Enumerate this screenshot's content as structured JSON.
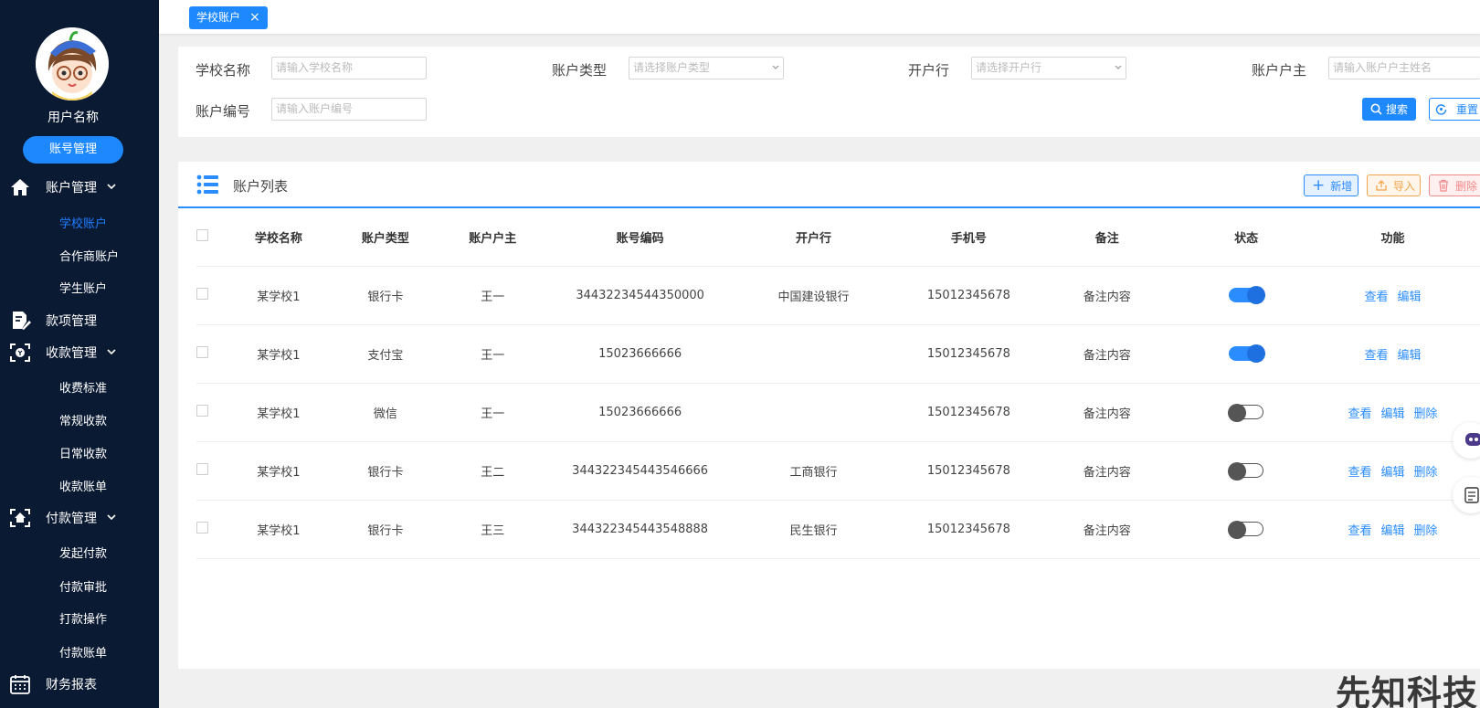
{
  "sidebar": {
    "user_name": "用户名称",
    "account_btn": "账号管理",
    "groups": [
      {
        "label": "账户管理",
        "icon": "home-icon"
      },
      {
        "label": "款项管理",
        "icon": "document-edit-icon"
      },
      {
        "label": "收款管理",
        "icon": "scan-yuan-icon"
      },
      {
        "label": "付款管理",
        "icon": "scan-home-icon"
      },
      {
        "label": "财务报表",
        "icon": "calendar-icon"
      }
    ],
    "account_items": [
      "学校账户",
      "合作商账户",
      "学生账户"
    ],
    "receipt_items": [
      "收费标准",
      "常规收款",
      "日常收款",
      "收款账单"
    ],
    "payment_items": [
      "发起付款",
      "付款审批",
      "打款操作",
      "付款账单"
    ]
  },
  "tabbar": {
    "active_tab": "学校账户"
  },
  "filter": {
    "school_name_label": "学校名称",
    "school_name_placeholder": "请输入学校名称",
    "account_type_label": "账户类型",
    "account_type_placeholder": "请选择账户类型",
    "bank_label": "开户行",
    "bank_placeholder": "请选择开户行",
    "owner_label": "账户户主",
    "owner_placeholder": "请输入账户户主姓名",
    "account_no_label": "账户编号",
    "account_no_placeholder": "请输入账户编号",
    "search_btn": "搜索",
    "reset_btn": "重置"
  },
  "list": {
    "title": "账户列表",
    "add_btn": "新增",
    "import_btn": "导入",
    "delete_btn": "删除",
    "columns": [
      "学校名称",
      "账户类型",
      "账户户主",
      "账号编码",
      "开户行",
      "手机号",
      "备注",
      "状态",
      "功能"
    ],
    "rows": [
      {
        "school": "某学校1",
        "type": "银行卡",
        "owner": "王一",
        "code": "34432234544350000",
        "bank": "中国建设银行",
        "phone": "15012345678",
        "note": "备注内容",
        "status": "on",
        "actions": [
          "查看",
          "编辑"
        ]
      },
      {
        "school": "某学校1",
        "type": "支付宝",
        "owner": "王一",
        "code": "15023666666",
        "bank": "",
        "phone": "15012345678",
        "note": "备注内容",
        "status": "on",
        "actions": [
          "查看",
          "编辑"
        ]
      },
      {
        "school": "某学校1",
        "type": "微信",
        "owner": "王一",
        "code": "15023666666",
        "bank": "",
        "phone": "15012345678",
        "note": "备注内容",
        "status": "off",
        "actions": [
          "查看",
          "编辑",
          "删除"
        ]
      },
      {
        "school": "某学校1",
        "type": "银行卡",
        "owner": "王二",
        "code": "344322345443546666",
        "bank": "工商银行",
        "phone": "15012345678",
        "note": "备注内容",
        "status": "off",
        "actions": [
          "查看",
          "编辑",
          "删除"
        ]
      },
      {
        "school": "某学校1",
        "type": "银行卡",
        "owner": "王三",
        "code": "344322345443548888",
        "bank": "民生银行",
        "phone": "15012345678",
        "note": "备注内容",
        "status": "off",
        "actions": [
          "查看",
          "编辑",
          "删除"
        ]
      }
    ]
  },
  "watermark": "先知科技",
  "colors": {
    "sidebar_bg": "#0b1a33",
    "primary": "#1e88ff",
    "active_nav": "#1e7dff",
    "import": "#f2a54a",
    "delete": "#f08a8a"
  }
}
